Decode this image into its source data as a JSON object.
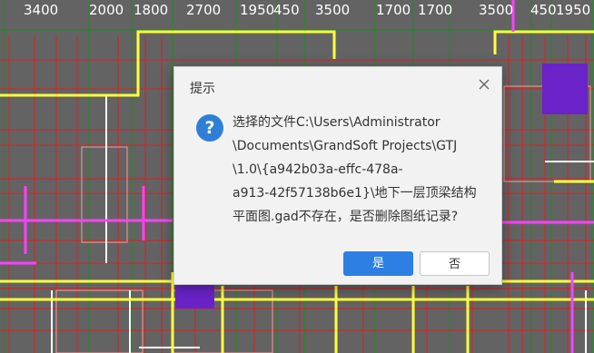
{
  "ruler": {
    "dimensions": [
      "3400",
      "2000",
      "1800",
      "2700",
      "1950",
      "450",
      "3500",
      "1700",
      "1700",
      "3500",
      "450",
      "1950"
    ]
  },
  "dialog": {
    "title": "提示",
    "icon": "question-icon",
    "icon_glyph": "?",
    "message_lines": [
      "选择的文件C:\\Users\\Administrator",
      "\\Documents\\GrandSoft Projects\\GTJ",
      "\\1.0\\{a942b03a-effc-478a-",
      "a913-42f57138b6e1}\\地下一层顶梁结构",
      "平面图.gad不存在，是否删除图纸记录?"
    ],
    "yes_label": "是",
    "no_label": "否"
  },
  "colors": {
    "background": "#636363",
    "beam_red": "#d92020",
    "beam_yellow": "#ffff40",
    "beam_magenta": "#ff40ff",
    "axis_green": "#1e8c1e",
    "fill_purple": "#6a23c8",
    "accent_blue": "#2d7fe3"
  }
}
